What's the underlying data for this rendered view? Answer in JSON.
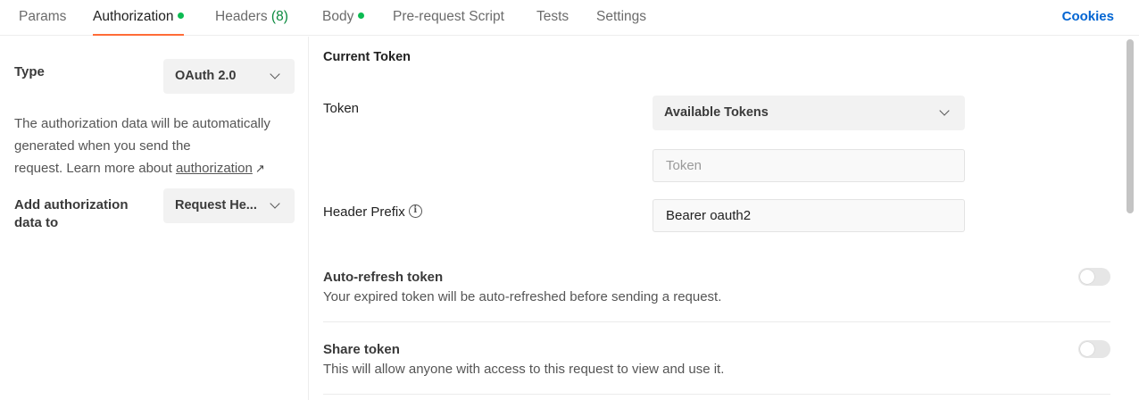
{
  "tabs": [
    {
      "label": "Params"
    },
    {
      "label": "Authorization",
      "has_dot": true
    },
    {
      "label": "Headers",
      "count": "(8)"
    },
    {
      "label": "Body",
      "has_dot": true
    },
    {
      "label": "Pre-request Script"
    },
    {
      "label": "Tests"
    },
    {
      "label": "Settings"
    }
  ],
  "active_tab": "Authorization",
  "cookies_label": "Cookies",
  "left": {
    "type_label": "Type",
    "type_value": "OAuth 2.0",
    "desc_line1": "The authorization data will be automatically",
    "desc_line2": "generated when you send the",
    "desc_line3": "request. Learn more about",
    "desc_link": "authorization",
    "desc_link_arrow": "↗",
    "add_to_label_line1": "Add authorization",
    "add_to_label_line2": "data to",
    "add_to_value": "Request He..."
  },
  "right": {
    "section_title": "Current Token",
    "token_label": "Token",
    "available_tokens": "Available Tokens",
    "token_placeholder": "Token",
    "header_prefix_label": "Header Prefix",
    "header_prefix_value": "Bearer oauth2",
    "auto_refresh_title": "Auto-refresh token",
    "auto_refresh_desc": "Your expired token will be auto-refreshed before sending a request.",
    "auto_refresh_on": false,
    "share_title": "Share token",
    "share_desc": "This will allow anyone with access to this request to view and use it.",
    "share_on": false
  },
  "colors": {
    "active_tab_underline": "#ff6c37",
    "status_dot": "#0cbb52",
    "cookies_link": "#0265d2"
  }
}
